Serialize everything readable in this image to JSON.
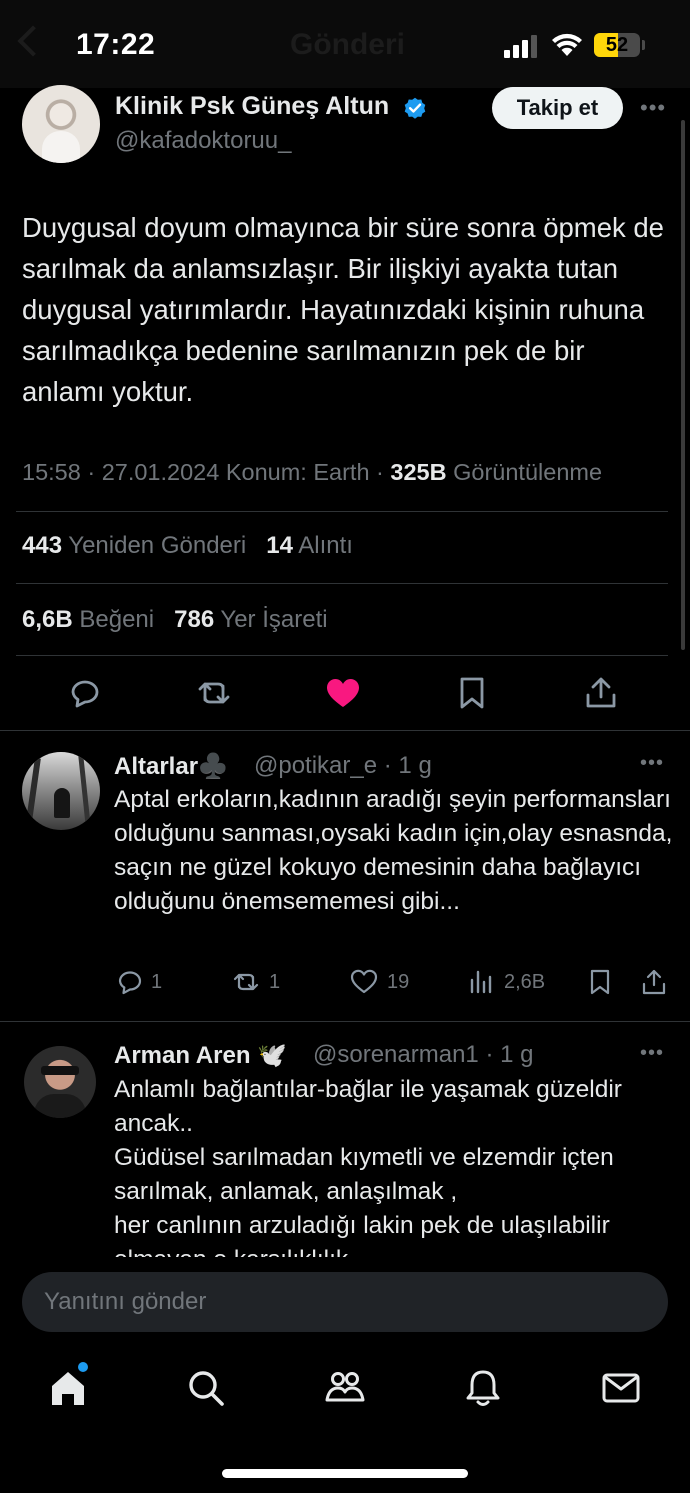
{
  "status_bar": {
    "time": "17:22",
    "ghost_title": "Gönderi",
    "battery_percent": 52,
    "battery_label": "52"
  },
  "tweet": {
    "author_name": "Klinik Psk Güneş Altun",
    "author_handle": "@kafadoktoruu_",
    "follow_label": "Takip et",
    "text": "Duygusal doyum olmayınca bir süre sonra öpmek de sarılmak da anlamsızlaşır. Bir ilişkiyi ayakta tutan duygusal yatırımlardır. Hayatınızdaki kişinin ruhuna sarılmadıkça bedenine sarılmanızın pek de bir anlamı yoktur.",
    "meta_prefix": "15:58 · 27.01.2024 Konum: Earth · ",
    "views_count": "325B",
    "views_label": " Görüntülenme",
    "reposts_count": "443",
    "reposts_label": " Yeniden Gönderi",
    "quotes_count": "14",
    "quotes_label": " Alıntı",
    "likes_count": "6,6B",
    "likes_label": " Beğeni",
    "bookmarks_count": "786",
    "bookmarks_label": " Yer İşareti",
    "colors": {
      "like": "#f91880",
      "verified": "#1d9bf0"
    }
  },
  "replies": [
    {
      "name": "Altarlar♣️",
      "handle": "@potikar_e · 1 g",
      "text": "Aptal erkoların,kadının aradığı şeyin performansları olduğunu sanması,oysaki kadın için,olay esnasnda, saçın ne güzel kokuyo demesinin daha bağlayıcı olduğunu önemsememesi gibi...",
      "replies": "1",
      "reposts": "1",
      "likes": "19",
      "views": "2,6B"
    },
    {
      "name": "Arman Aren 🕊️",
      "handle": "@sorenarman1 · 1 g",
      "text": "Anlamlı bağlantılar-bağlar ile yaşamak güzeldir ancak..\nGüdüsel sarılmadan kıymetli ve elzemdir içten sarılmak, anlamak, anlaşılmak ,\nher canlının arzuladığı lakin pek de ulaşılabilir olmayan o karşılıklılık..."
    }
  ],
  "composer": {
    "placeholder": "Yanıtını gönder"
  },
  "tab_bar": [
    "home-icon",
    "search-icon",
    "communities-icon",
    "notifications-icon",
    "messages-icon"
  ]
}
